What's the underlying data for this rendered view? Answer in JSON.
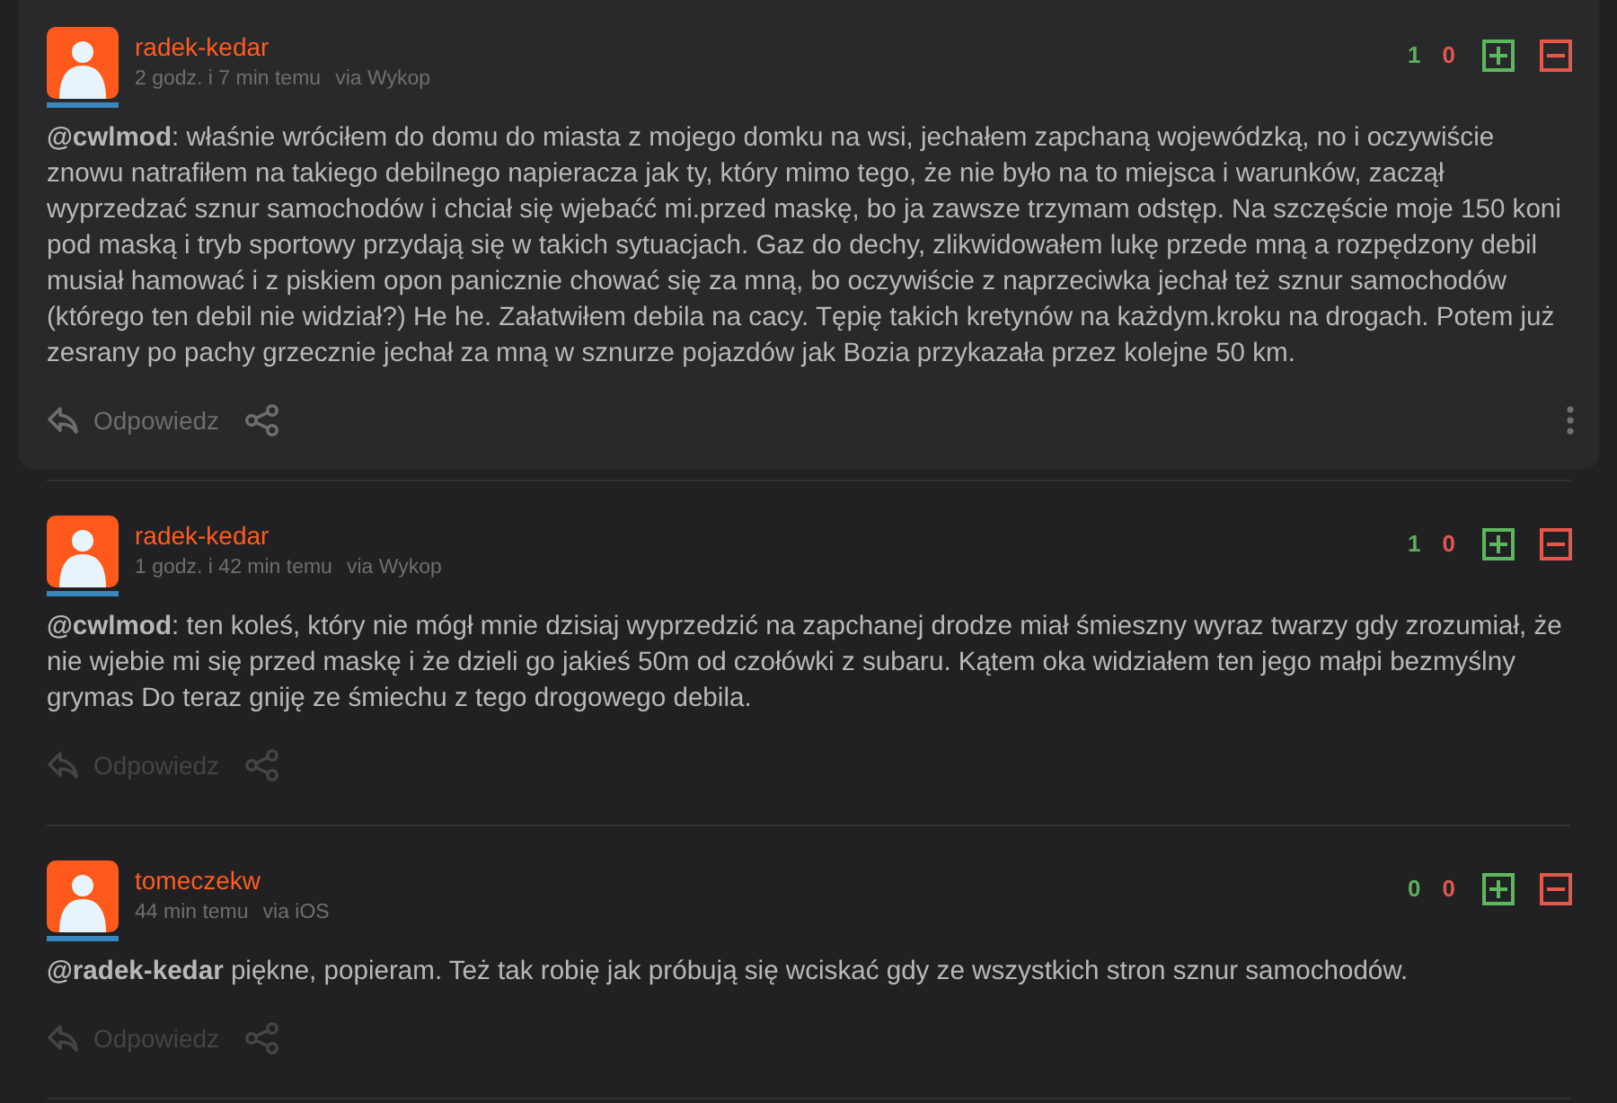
{
  "comments": [
    {
      "highlighted": true,
      "author": "radek-kedar",
      "time": "2 godz. i 7 min temu",
      "via": "via Wykop",
      "plus_count": "1",
      "minus_count": "0",
      "body": "**@cwlmod**: właśnie wróciłem do domu do miasta z mojego domku na wsi, jechałem zapchaną wojewódzką, no i oczywiście znowu natrafiłem na takiego debilnego napieracza jak ty, który mimo tego, że nie było na to miejsca i warunków, zaczął wyprzedzać sznur samochodów i chciał się wjebaćć mi.przed maskę, bo ja zawsze trzymam odstęp. Na szczęście moje 150 koni pod maską i tryb sportowy przydają się w takich sytuacjach. Gaz do dechy, zlikwidowałem lukę przede mną a rozpędzony debil musiał hamować i z piskiem opon panicznie chować się za mną, bo oczywiście z naprzeciwka jechał też sznur samochodów (którego ten debil nie widział?) He he. Załatwiłem debila na cacy. Tępię takich kretynów na każdym.kroku na drogach. Potem już zesrany po pachy grzecznie jechał za mną w sznurze pojazdów jak Bozia przykazała przez kolejne 50 km.",
      "reply_label": "Odpowiedz"
    },
    {
      "highlighted": false,
      "author": "radek-kedar",
      "time": "1 godz. i 42 min temu",
      "via": "via Wykop",
      "plus_count": "1",
      "minus_count": "0",
      "body": "**@cwlmod**: ten koleś, który nie mógł mnie dzisiaj wyprzedzić na zapchanej drodze miał śmieszny wyraz twarzy gdy zrozumiał, że nie wjebie mi się przed maskę i że dzieli go jakieś 50m od czołówki z subaru. Kątem oka widziałem ten jego małpi bezmyślny grymas Do teraz gniję ze śmiechu z tego drogowego debila.",
      "reply_label": "Odpowiedz"
    },
    {
      "highlighted": false,
      "author": "tomeczekw",
      "time": "44 min temu",
      "via": "via iOS",
      "plus_count": "0",
      "minus_count": "0",
      "body": "**@radek-kedar** piękne, popieram. Też tak robię jak próbują się wciskać gdy ze wszystkich stron sznur samochodów.",
      "reply_label": "Odpowiedz"
    }
  ]
}
